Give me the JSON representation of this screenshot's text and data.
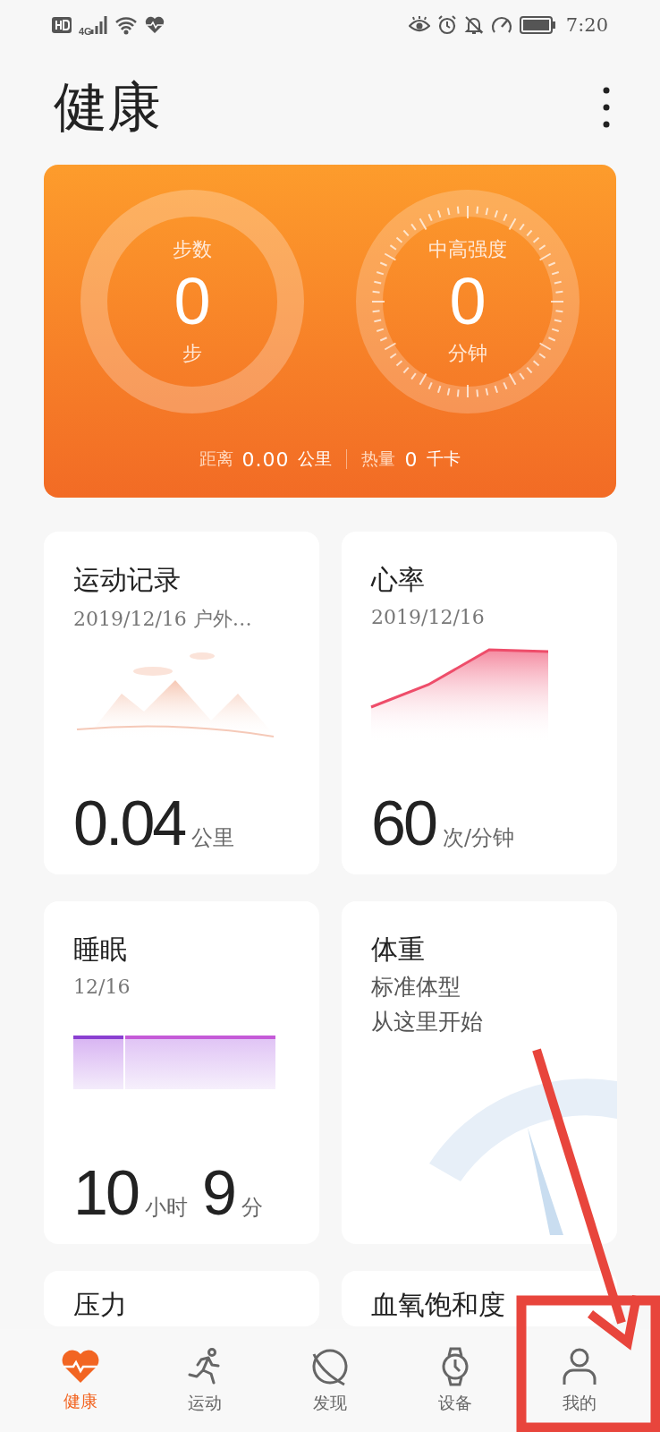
{
  "status_bar": {
    "network": "4G",
    "time": "7:20"
  },
  "header": {
    "title": "健康"
  },
  "summary": {
    "rings": [
      {
        "kind": "plain",
        "label": "步数",
        "value": "0",
        "unit": "步"
      },
      {
        "kind": "ticks",
        "label": "中高强度",
        "value": "0",
        "unit": "分钟"
      }
    ],
    "stats": [
      {
        "label": "距离",
        "value": "0.00",
        "unit": "公里"
      },
      {
        "label": "热量",
        "value": "0",
        "unit": "千卡"
      }
    ]
  },
  "cards": [
    {
      "kind": "exercise",
      "title": "运动记录",
      "subtitle": "2019/12/16 户外…",
      "readings": [
        {
          "value": "0.04",
          "unit": "公里"
        }
      ]
    },
    {
      "kind": "heart",
      "title": "心率",
      "subtitle": "2019/12/16",
      "readings": [
        {
          "value": "60",
          "unit": "次/分钟"
        }
      ]
    },
    {
      "kind": "sleep",
      "title": "睡眠",
      "subtitle": "12/16",
      "readings": [
        {
          "value": "10",
          "unit": "小时"
        },
        {
          "value": "9",
          "unit": "分"
        }
      ]
    },
    {
      "kind": "weight",
      "title": "体重",
      "lines": [
        "标准体型",
        "从这里开始"
      ]
    },
    {
      "kind": "plain",
      "title": "压力"
    },
    {
      "kind": "plain",
      "title": "血氧饱和度"
    }
  ],
  "nav": [
    {
      "kind": "heart",
      "label": "健康",
      "selected": true
    },
    {
      "kind": "run",
      "label": "运动",
      "selected": false
    },
    {
      "kind": "planet",
      "label": "发现",
      "selected": false
    },
    {
      "kind": "watch",
      "label": "设备",
      "selected": false
    },
    {
      "kind": "person",
      "label": "我的",
      "selected": false
    }
  ]
}
